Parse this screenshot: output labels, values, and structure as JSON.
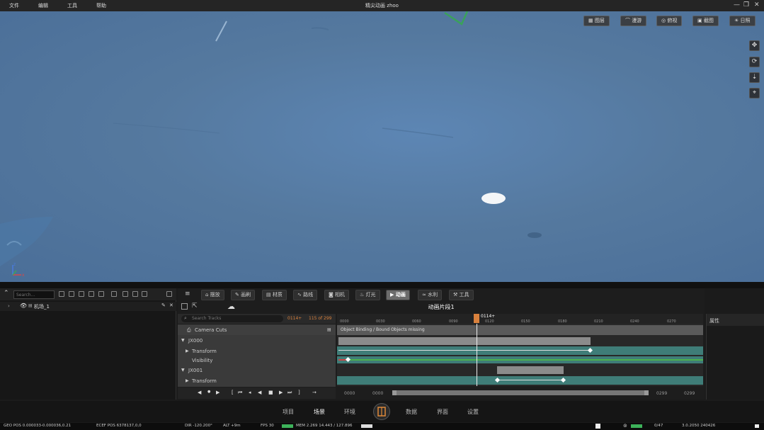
{
  "menu": {
    "items": [
      "文件",
      "编辑",
      "工具",
      "帮助"
    ]
  },
  "window": {
    "title": "精尖动画 zhoo",
    "min": "—",
    "max": "❐",
    "close": "✕"
  },
  "viewport": {
    "top_buttons": [
      "图层",
      "漫游",
      "俯视",
      "截图",
      "日照"
    ],
    "side_icons": [
      "move-icon",
      "orbit-icon",
      "pan-icon",
      "camera-icon"
    ],
    "axis": {
      "z": "z",
      "x": "x"
    }
  },
  "outliner": {
    "search_placeholder": "Search...",
    "root_item": "机场_1"
  },
  "sequencer": {
    "tabs": [
      "摆放",
      "画刷",
      "材质",
      "路线",
      "相机",
      "灯光",
      "动画",
      "水利",
      "工具"
    ],
    "active_tab": "动画",
    "clip_title": "动画片段1",
    "search_placeholder": "Search Tracks",
    "current_frame": "0114+",
    "frame_count": "115 of 299",
    "playhead_label": "0114+",
    "warning_text": "Object Binding / Bound Objects missing",
    "tracks": [
      {
        "label": "Camera Cuts"
      },
      {
        "label": "JX000"
      },
      {
        "label": "Transform"
      },
      {
        "label": "Visibility"
      },
      {
        "label": "JX001"
      },
      {
        "label": "Transform"
      }
    ],
    "ruler_ticks": [
      "0000",
      "0030",
      "0060",
      "0090",
      "0120",
      "0150",
      "0180",
      "0210",
      "0240",
      "0270"
    ],
    "range_start": "0000",
    "range_start2": "0000",
    "range_end": "0299",
    "range_end2": "0299",
    "transport": [
      "◀",
      "●",
      "▶",
      "[",
      "⏮",
      "◂",
      "◀",
      "■",
      "▶",
      "⏭",
      "]",
      "→"
    ]
  },
  "properties": {
    "title": "属性"
  },
  "bottom_nav": {
    "items": [
      "项目",
      "场景",
      "环境",
      "数据",
      "界面",
      "设置"
    ],
    "active": "场景"
  },
  "status": {
    "geo_pos": "GEO POS  0.000033-0.000036,0.21",
    "ecef_pos": "ECEF POS  6378137,0,0",
    "dir": "DIR  -120.200°",
    "alt": "ALT  +9m",
    "fps": "FPS  30",
    "mem": "MEM  2.269  14.443 / 127.896",
    "counter": "0/47",
    "version": "3.0.2050 240426"
  },
  "colors": {
    "accent": "#d9813d",
    "track_teal": "#3f7d78",
    "viewport": "#5a80ad"
  }
}
